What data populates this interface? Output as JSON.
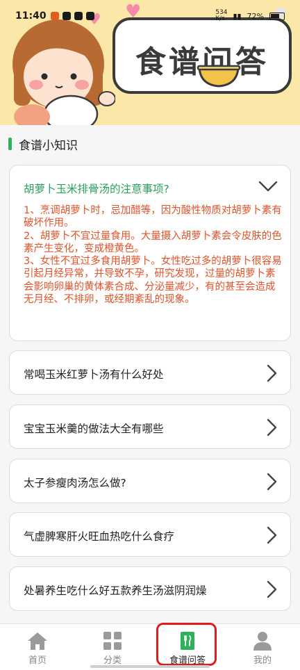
{
  "status_bar": {
    "time": "11:40",
    "network_speed": "534\nK/s",
    "battery": "72%"
  },
  "banner": {
    "title": "食谱问答"
  },
  "section": {
    "title": "食谱小知识"
  },
  "expanded": {
    "question": "胡萝卜玉米排骨汤的注意事项?",
    "answer": "1、烹调胡萝卜时，忌加醋等，因为酸性物质对胡萝卜素有破坏作用。\n2、胡萝卜不宜过量食用。大量摄入胡萝卜素会令皮肤的色素产生变化，变成橙黄色。\n3、女性不宜过多食用胡萝卜。女性吃过多的胡萝卜很容易引起月经异常，并导致不孕，研究发现，过量的胡萝卜素会影响卵巢的黄体素合成、分泌量减少，有的甚至会造成无月经、不排卵，或经期紊乱的现象。"
  },
  "questions": [
    {
      "label": "常喝玉米红萝卜汤有什么好处"
    },
    {
      "label": "宝宝玉米羹的做法大全有哪些"
    },
    {
      "label": "太子参瘦肉汤怎么做?"
    },
    {
      "label": "气虚脾寒肝火旺血热吃什么食疗"
    },
    {
      "label": "处暑养生吃什么好五款养生汤滋阴润燥"
    }
  ],
  "nav": [
    {
      "label": "首页",
      "icon": "home-icon"
    },
    {
      "label": "分类",
      "icon": "grid-icon"
    },
    {
      "label": "食谱问答",
      "icon": "recipe-book-icon",
      "active": true
    },
    {
      "label": "我的",
      "icon": "person-icon"
    }
  ],
  "colors": {
    "accent": "#2fb05b",
    "answer": "#e0532b",
    "banner": "#fbe7a8",
    "highlight": "#e11b1b"
  }
}
